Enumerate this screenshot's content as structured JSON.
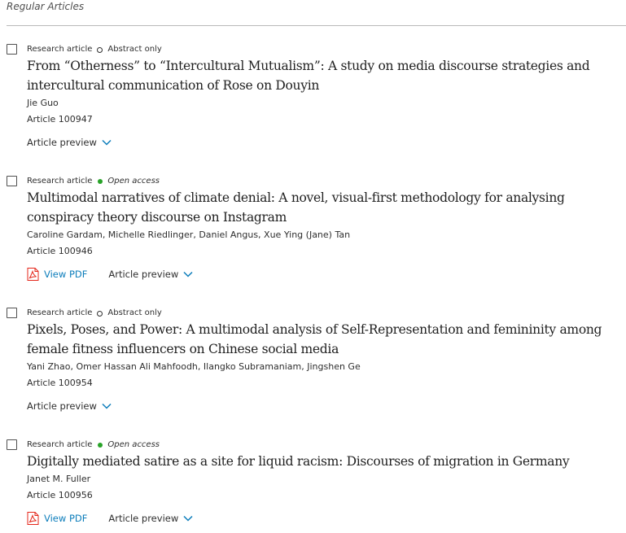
{
  "section_title": "Regular Articles",
  "articles": [
    {
      "type": "Research article",
      "access": "Abstract only",
      "title": "From “Otherness” to “Intercultural Mutualism”: A study on media discourse strategies and intercultural communication of Rose on Douyin",
      "authors": "Jie Guo",
      "article_no": "Article 100947",
      "has_pdf": false,
      "preview_label": "Article preview"
    },
    {
      "type": "Research article",
      "access": "Open access",
      "title": "Multimodal narratives of climate denial: A novel, visual-first methodology for analysing conspiracy theory discourse on Instagram",
      "authors": "Caroline Gardam, Michelle Riedlinger, Daniel Angus, Xue Ying (Jane) Tan",
      "article_no": "Article 100946",
      "has_pdf": true,
      "pdf_label": "View PDF",
      "preview_label": "Article preview"
    },
    {
      "type": "Research article",
      "access": "Abstract only",
      "title": "Pixels, Poses, and Power: A multimodal analysis of Self-Representation and femininity among female fitness influencers on Chinese social media",
      "authors": "Yani Zhao, Omer Hassan Ali Mahfoodh, Ilangko Subramaniam, Jingshen Ge",
      "article_no": "Article 100954",
      "has_pdf": false,
      "preview_label": "Article preview"
    },
    {
      "type": "Research article",
      "access": "Open access",
      "title": "Digitally mediated satire as a site for liquid racism: Discourses of migration in Germany",
      "authors": "Janet M. Fuller",
      "article_no": "Article 100956",
      "has_pdf": true,
      "pdf_label": "View PDF",
      "preview_label": "Article preview"
    }
  ],
  "colors": {
    "link_blue": "#0c7dbb",
    "open_access_green": "#29a329",
    "pdf_red": "#e4261a"
  }
}
